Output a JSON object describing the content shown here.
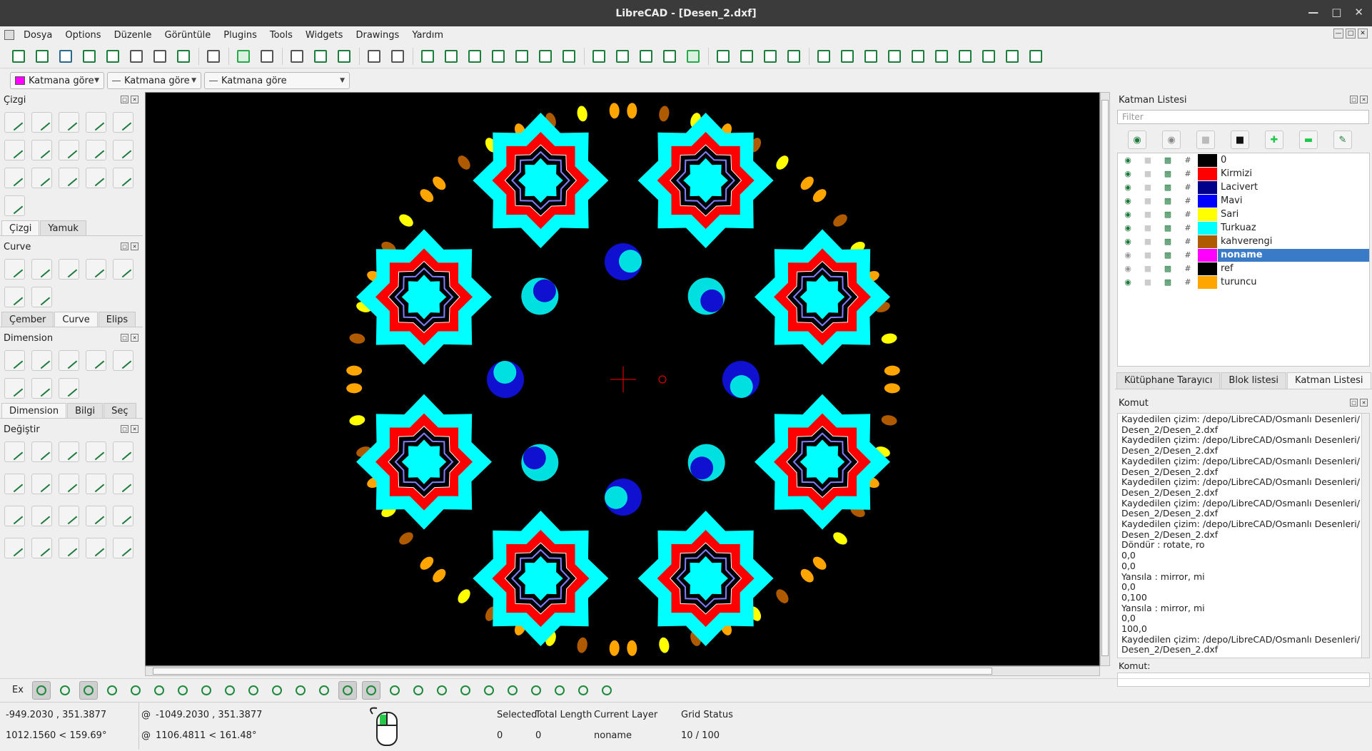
{
  "window": {
    "title": "LibreCAD - [Desen_2.dxf]"
  },
  "menu": [
    "Dosya",
    "Options",
    "Düzenle",
    "Görüntüle",
    "Plugins",
    "Tools",
    "Widgets",
    "Drawings",
    "Yardım"
  ],
  "props": {
    "color": "Katmana göre",
    "linetype": "Katmana göre",
    "linewidth": "Katmana göre",
    "color_swatch": "#ff00ff"
  },
  "left": {
    "cizgi": {
      "title": "Çizgi"
    },
    "tabs1": [
      "Çizgi",
      "Yamuk"
    ],
    "curve": {
      "title": "Curve"
    },
    "tabs2": [
      "Çember",
      "Curve",
      "Elips"
    ],
    "dimension": {
      "title": "Dimension"
    },
    "tabs3": [
      "Dimension",
      "Bilgi",
      "Seç"
    ],
    "degistir": {
      "title": "Değiştir"
    }
  },
  "layers": {
    "title": "Katman Listesi",
    "filter_placeholder": "Filter",
    "rows": [
      {
        "name": "0",
        "color": "#000000"
      },
      {
        "name": "Kirmizi",
        "color": "#ff0000"
      },
      {
        "name": "Lacivert",
        "color": "#00008b"
      },
      {
        "name": "Mavi",
        "color": "#0000ff"
      },
      {
        "name": "Sari",
        "color": "#ffff00"
      },
      {
        "name": "Turkuaz",
        "color": "#00ffff"
      },
      {
        "name": "kahverengi",
        "color": "#b05a00"
      },
      {
        "name": "noname",
        "color": "#ff00ff"
      },
      {
        "name": "ref",
        "color": "#000000"
      },
      {
        "name": "turuncu",
        "color": "#ffa500"
      }
    ],
    "tabs": [
      "Kütüphane Tarayıcı",
      "Blok listesi",
      "Katman Listesi"
    ]
  },
  "command": {
    "title": "Komut",
    "input_label": "Komut:",
    "log": [
      "Kaydedilen çizim: /depo/LibreCAD/Osmanlı Desenleri/",
      "Desen_2/Desen_2.dxf",
      "Kaydedilen çizim: /depo/LibreCAD/Osmanlı Desenleri/",
      "Desen_2/Desen_2.dxf",
      "Kaydedilen çizim: /depo/LibreCAD/Osmanlı Desenleri/",
      "Desen_2/Desen_2.dxf",
      "Kaydedilen çizim: /depo/LibreCAD/Osmanlı Desenleri/",
      "Desen_2/Desen_2.dxf",
      "Kaydedilen çizim: /depo/LibreCAD/Osmanlı Desenleri/",
      "Desen_2/Desen_2.dxf",
      "Kaydedilen çizim: /depo/LibreCAD/Osmanlı Desenleri/",
      "Desen_2/Desen_2.dxf",
      "Döndür : rotate, ro",
      "0,0",
      "0,0",
      "Yansıla : mirror, mi",
      "0,0",
      "0,100",
      "Yansıla : mirror, mi",
      "0,0",
      "100,0",
      "Kaydedilen çizim: /depo/LibreCAD/Osmanlı Desenleri/",
      "Desen_2/Desen_2.dxf"
    ]
  },
  "snap": {
    "ex_label": "Ex"
  },
  "status": {
    "abs1": "-949.2030 , 351.3877",
    "abs2": "1012.1560 < 159.69°",
    "rel1": "-1049.2030 , 351.3877",
    "rel2": "1106.4811 < 161.48°",
    "rel_prefix": "@",
    "selected_label": "Selected",
    "selected_val": "0",
    "total_label": "Total Length",
    "total_val": "0",
    "layer_label": "Current Layer",
    "layer_val": "noname",
    "grid_label": "Grid Status",
    "grid_val": "10 / 100"
  }
}
